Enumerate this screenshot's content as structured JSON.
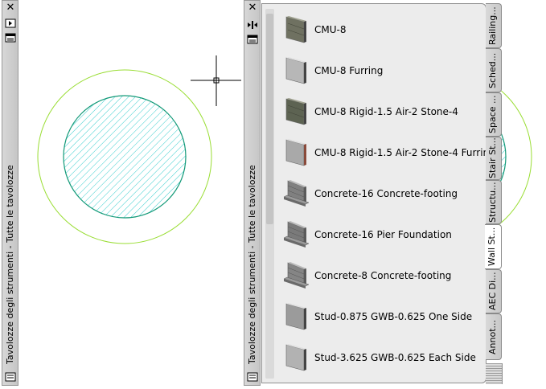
{
  "left_palette": {
    "title": "Tavolozze degli strumenti - Tutte le tavolozze",
    "close_label": "✕"
  },
  "right_palette": {
    "title": "Tavolozze degli strumenti - Tutte le tavolozze",
    "close_label": "✕",
    "tools": [
      {
        "label": "CMU-8",
        "icon": "cmu-wall-icon",
        "color": "#6f7161"
      },
      {
        "label": "CMU-8 Furring",
        "icon": "furring-wall-icon",
        "color": "#b7b7b7"
      },
      {
        "label": "CMU-8 Rigid-1.5 Air-2 Stone-4",
        "icon": "cmu-wall-icon",
        "color": "#5d6352"
      },
      {
        "label": "CMU-8 Rigid-1.5 Air-2 Stone-4 Furring",
        "icon": "furring-wall-icon",
        "color": "#a9a9a9"
      },
      {
        "label": "Concrete-16 Concrete-footing",
        "icon": "footing-wall-icon",
        "color": "#808080"
      },
      {
        "label": "Concrete-16 Pier Foundation",
        "icon": "footing-wall-icon",
        "color": "#7a7a7a"
      },
      {
        "label": "Concrete-8 Concrete-footing",
        "icon": "footing-wall-icon",
        "color": "#858585"
      },
      {
        "label": "Stud-0.875 GWB-0.625 One Side",
        "icon": "stud-wall-icon",
        "color": "#9b9b9b"
      },
      {
        "label": "Stud-3.625 GWB-0.625 Each Side",
        "icon": "stud-wall-icon",
        "color": "#b2b2b2"
      }
    ],
    "tabs": [
      {
        "label": "Railing...",
        "active": false
      },
      {
        "label": "Sched...",
        "active": false
      },
      {
        "label": "Space ...",
        "active": false
      },
      {
        "label": "Stair St...",
        "active": false
      },
      {
        "label": "Structu...",
        "active": false
      },
      {
        "label": "Wall St...",
        "active": true
      },
      {
        "label": "AEC Di...",
        "active": false
      },
      {
        "label": "Annot...",
        "active": false
      }
    ]
  },
  "drawing": {
    "outer_circle_color": "#99dd33",
    "inner_circle_color": "#119977",
    "hatch_color": "#33cccc",
    "crosshair_color": "#000000"
  }
}
